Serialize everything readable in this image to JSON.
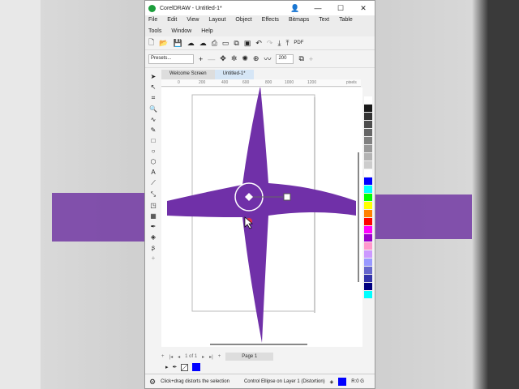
{
  "window": {
    "title": "CorelDRAW - Untitled-1*",
    "min": "—",
    "max": "☐",
    "close": "✕"
  },
  "menu": [
    "File",
    "Edit",
    "View",
    "Layout",
    "Object",
    "Effects",
    "Bitmaps",
    "Text",
    "Table",
    "Tools",
    "Window",
    "Help"
  ],
  "propbar": {
    "presets": "Presets...",
    "value": "200"
  },
  "tabs": [
    "Welcome Screen",
    "Untitled-1*"
  ],
  "ruler": [
    "0",
    "200",
    "400",
    "600",
    "800",
    "1000",
    "1200",
    "pixels"
  ],
  "pager": {
    "count": "1 of 1",
    "page": "Page 1"
  },
  "status": {
    "hint": "Click+drag distorts the selection",
    "object": "Control Ellipse on Layer 1 (Distortion)",
    "coords": "R:0 G"
  },
  "colors": {
    "shape": "#7030a8",
    "fill": "#0000ff"
  },
  "palette": [
    "#ffffff",
    "#1a1a1a",
    "#333333",
    "#4d4d4d",
    "#666666",
    "#808080",
    "#999999",
    "#b3b3b3",
    "#cccccc",
    "#ffffff",
    "#0000ff",
    "#00ffff",
    "#00ff00",
    "#ffff00",
    "#ff8000",
    "#ff0000",
    "#ff00ff",
    "#9900cc",
    "#ff99cc",
    "#cc99ff",
    "#9999ff",
    "#6666cc",
    "#3333aa",
    "#000080",
    "#00ffff"
  ]
}
